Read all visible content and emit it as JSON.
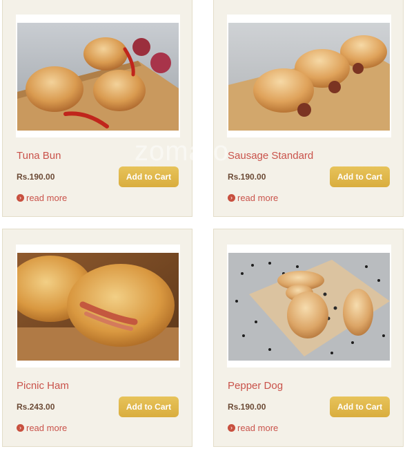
{
  "products": [
    {
      "title": "Tuna Bun",
      "price": "Rs.190.00",
      "button_label": "Add to Cart",
      "read_more_label": "read more",
      "image_alt": "Tuna Bun"
    },
    {
      "title": "Sausage Standard",
      "price": "Rs.190.00",
      "button_label": "Add to Cart",
      "read_more_label": "read more",
      "image_alt": "Sausage Standard"
    },
    {
      "title": "Picnic Ham",
      "price": "Rs.243.00",
      "button_label": "Add to Cart",
      "read_more_label": "read more",
      "image_alt": "Picnic Ham"
    },
    {
      "title": "Pepper Dog",
      "price": "Rs.190.00",
      "button_label": "Add to Cart",
      "read_more_label": "read more",
      "image_alt": "Pepper Dog"
    }
  ],
  "watermark": "zomato",
  "colors": {
    "card_bg": "#f4f1e8",
    "title": "#c9524a",
    "price": "#6b4a35",
    "button": "#deb54a"
  },
  "icons": {
    "read_more": "arrow-circle-icon"
  }
}
